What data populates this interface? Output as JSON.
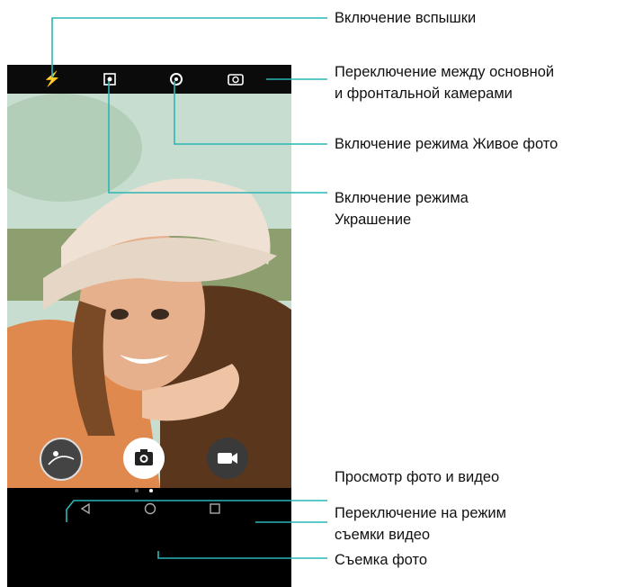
{
  "callouts": {
    "flash": "Включение вспышки",
    "switch_camera": "Переключение между основной\nи фронтальной камерами",
    "live_photo": "Включение режима Живое фото",
    "beauty": "Включение режима\nУкрашение",
    "gallery": "Просмотр фото и видео",
    "video_mode": "Переключение на режим\nсъемки видео",
    "capture": "Съемка фото"
  },
  "colors": {
    "callout_line": "#2ab6b6",
    "phone_bg": "#000000",
    "text": "#111111"
  },
  "icons": {
    "flash": "flash-icon",
    "beauty": "beauty-icon",
    "live": "live-photo-icon",
    "switch": "switch-camera-icon",
    "gallery": "gallery-icon",
    "shutter": "camera-icon",
    "video": "video-icon",
    "nav_back": "back-icon",
    "nav_home": "home-icon",
    "nav_recent": "recent-apps-icon"
  }
}
